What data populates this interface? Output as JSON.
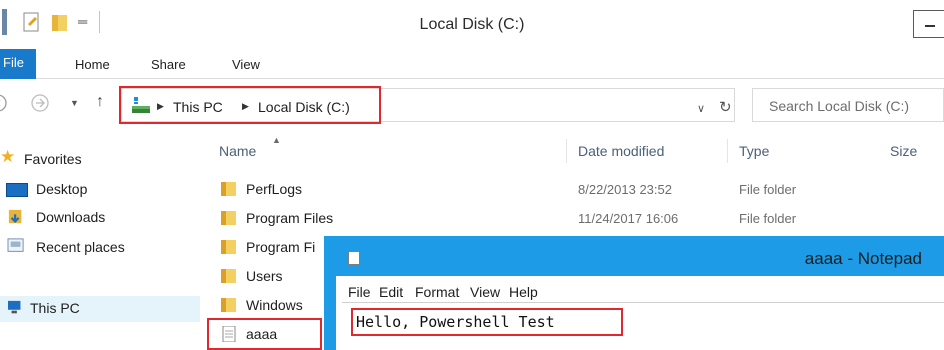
{
  "window": {
    "title": "Local Disk (C:)"
  },
  "ribbon": {
    "tabs": [
      "File",
      "Home",
      "Share",
      "View"
    ]
  },
  "address": {
    "crumbs": [
      "This PC",
      "Local Disk (C:)"
    ],
    "search_placeholder": "Search Local Disk (C:)"
  },
  "nav": {
    "favorites": "Favorites",
    "items": [
      "Desktop",
      "Downloads",
      "Recent places"
    ],
    "this_pc": "This PC"
  },
  "columns": {
    "name": "Name",
    "date": "Date modified",
    "type": "Type",
    "size": "Size"
  },
  "files": [
    {
      "name": "PerfLogs",
      "date": "8/22/2013 23:52",
      "type": "File folder"
    },
    {
      "name": "Program Files",
      "date": "11/24/2017 16:06",
      "type": "File folder"
    },
    {
      "name": "Program Fi",
      "date": "",
      "type": ""
    },
    {
      "name": "Users",
      "date": "",
      "type": ""
    },
    {
      "name": "Windows",
      "date": "",
      "type": ""
    },
    {
      "name": "aaaa",
      "date": "",
      "type": ""
    }
  ],
  "notepad": {
    "title": "aaaa - Notepad",
    "menus": [
      "File",
      "Edit",
      "Format",
      "View",
      "Help"
    ],
    "content": "Hello, Powershell Test"
  },
  "colors": {
    "accent": "#1979ca",
    "notepad_frame": "#1d9be6",
    "highlight": "#e0282e",
    "folder": "#e8b53a"
  }
}
